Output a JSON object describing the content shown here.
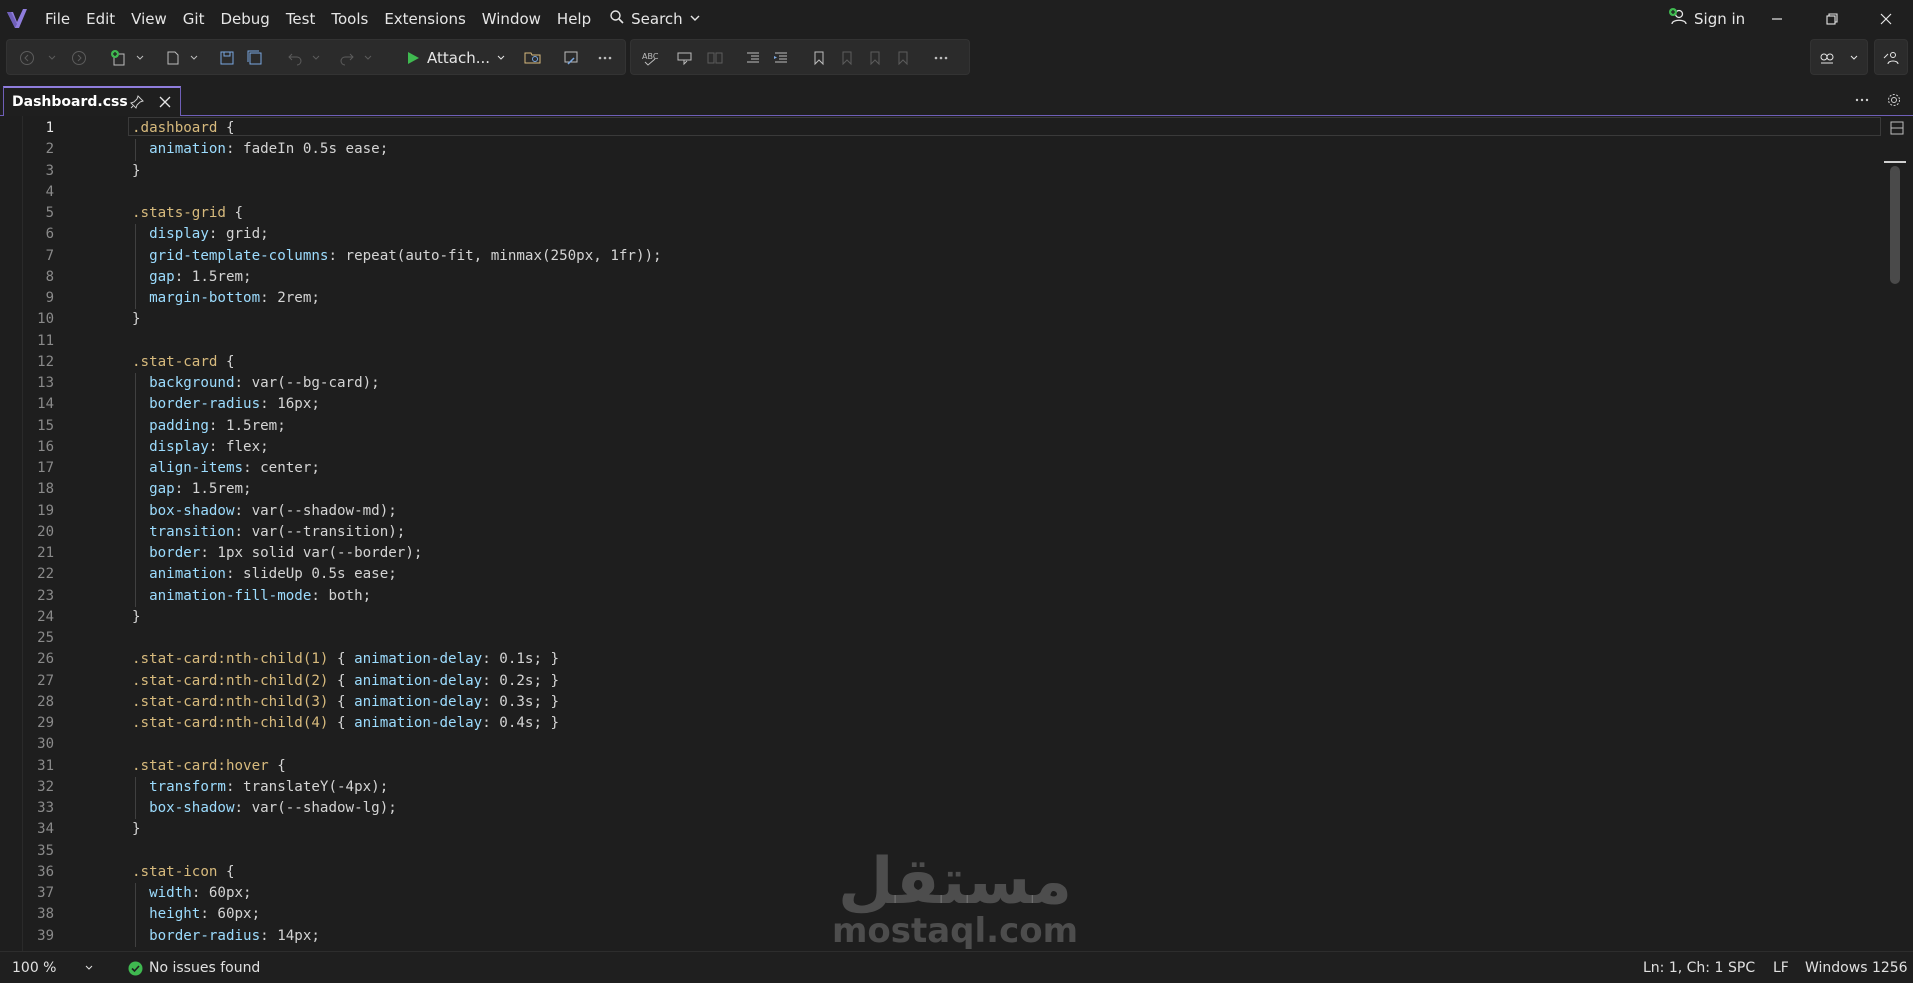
{
  "app": {
    "menu": [
      "File",
      "Edit",
      "View",
      "Git",
      "Debug",
      "Test",
      "Tools",
      "Extensions",
      "Window",
      "Help"
    ],
    "search_label": "Search",
    "signin_label": "Sign in"
  },
  "toolbar": {
    "attach_label": "Attach..."
  },
  "tab": {
    "label": "Dashboard.css"
  },
  "editor": {
    "lines": [
      ".dashboard {",
      "  animation: fadeIn 0.5s ease;",
      "}",
      "",
      ".stats-grid {",
      "  display: grid;",
      "  grid-template-columns: repeat(auto-fit, minmax(250px, 1fr));",
      "  gap: 1.5rem;",
      "  margin-bottom: 2rem;",
      "}",
      "",
      ".stat-card {",
      "  background: var(--bg-card);",
      "  border-radius: 16px;",
      "  padding: 1.5rem;",
      "  display: flex;",
      "  align-items: center;",
      "  gap: 1.5rem;",
      "  box-shadow: var(--shadow-md);",
      "  transition: var(--transition);",
      "  border: 1px solid var(--border);",
      "  animation: slideUp 0.5s ease;",
      "  animation-fill-mode: both;",
      "}",
      "",
      ".stat-card:nth-child(1) { animation-delay: 0.1s; }",
      ".stat-card:nth-child(2) { animation-delay: 0.2s; }",
      ".stat-card:nth-child(3) { animation-delay: 0.3s; }",
      ".stat-card:nth-child(4) { animation-delay: 0.4s; }",
      "",
      ".stat-card:hover {",
      "  transform: translateY(-4px);",
      "  box-shadow: var(--shadow-lg);",
      "}",
      "",
      ".stat-icon {",
      "  width: 60px;",
      "  height: 60px;",
      "  border-radius: 14px;"
    ],
    "active_line": 1
  },
  "statusbar": {
    "zoom": "100 %",
    "issues": "No issues found",
    "position": "Ln: 1, Ch: 1",
    "whitespace": "SPC",
    "line_ending": "LF",
    "encoding": "Windows 1256"
  },
  "watermark": {
    "arabic": "مستقل",
    "latin": "mostaql.com"
  },
  "colors": {
    "selector": "#d7ba7d",
    "property": "#9cdcfe",
    "value": "#d4d4d4",
    "accent": "#8f7ddc",
    "ok": "#3fb950"
  }
}
